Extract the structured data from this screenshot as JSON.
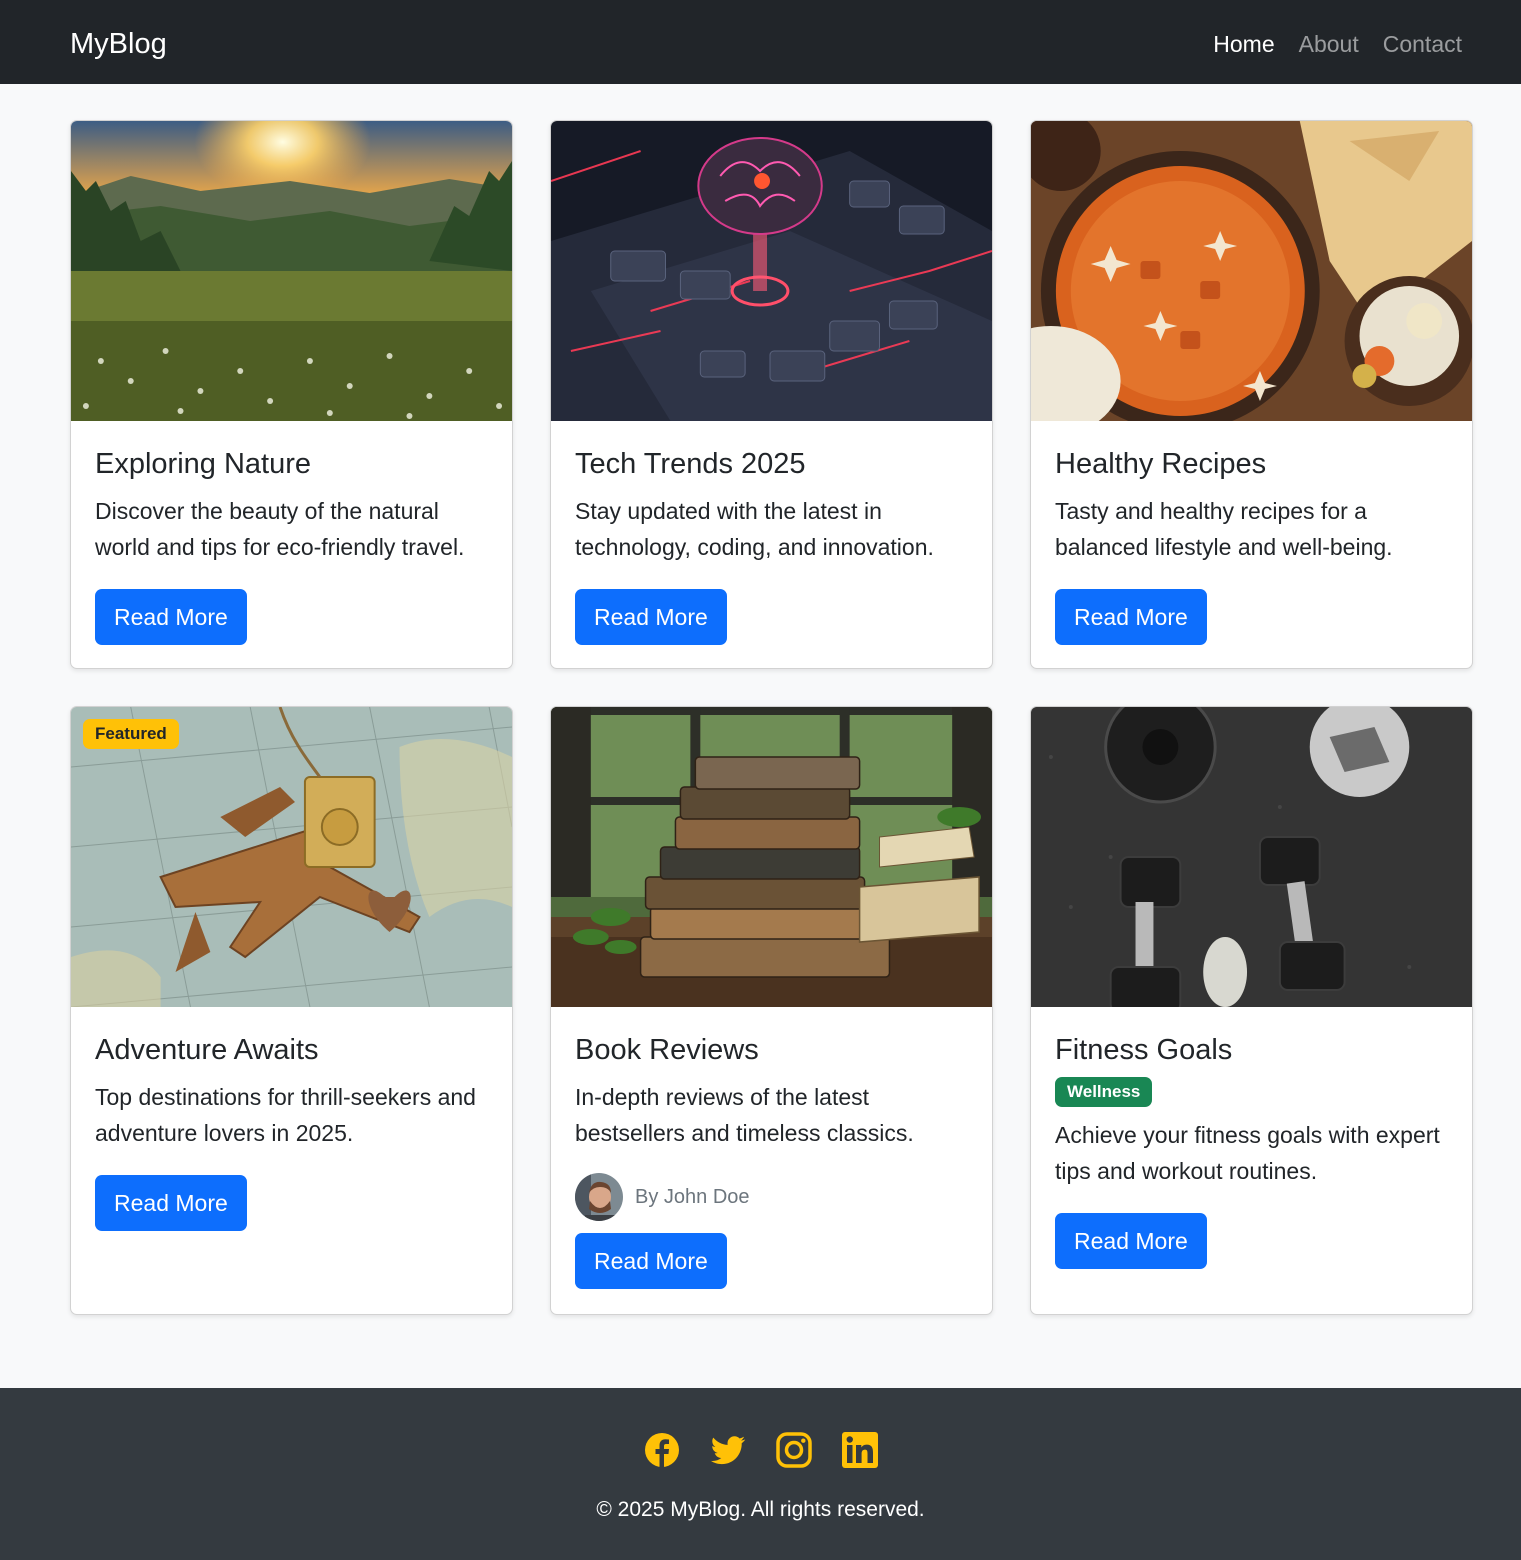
{
  "navbar": {
    "brand": "MyBlog",
    "links": [
      "Home",
      "About",
      "Contact"
    ],
    "active": "Home"
  },
  "posts": [
    {
      "title": "Exploring Nature",
      "text": "Discover the beauty of the natural world and tips for eco-friendly travel.",
      "button": "Read More",
      "image": "sunset-meadow-image"
    },
    {
      "title": "Tech Trends 2025",
      "text": "Stay updated with the latest in technology, coding, and innovation.",
      "button": "Read More",
      "image": "circuit-brain-image"
    },
    {
      "title": "Healthy Recipes",
      "text": "Tasty and healthy recipes for a balanced lifestyle and well-being.",
      "button": "Read More",
      "image": "curry-food-image"
    },
    {
      "title": "Adventure Awaits",
      "text": "Top destinations for thrill-seekers and adventure lovers in 2025.",
      "button": "Read More",
      "image": "map-airplane-image",
      "badge": "Featured"
    },
    {
      "title": "Book Reviews",
      "text": "In-depth reviews of the latest bestsellers and timeless classics.",
      "button": "Read More",
      "image": "book-stack-image",
      "author": "By John Doe"
    },
    {
      "title": "Fitness Goals",
      "text": "Achieve your fitness goals with expert tips and workout routines.",
      "button": "Read More",
      "image": "dumbbells-image",
      "badge": "Wellness"
    }
  ],
  "footer": {
    "social": [
      "facebook-icon",
      "twitter-icon",
      "instagram-icon",
      "linkedin-icon"
    ],
    "copyright": "© 2025 MyBlog. All rights reserved.",
    "icon_color": "#ffc107"
  },
  "colors": {
    "navbar_bg": "#212529",
    "footer_bg": "#343a40",
    "primary": "#0d6efd",
    "featured_badge": "#ffc107",
    "wellness_badge": "#198754"
  }
}
